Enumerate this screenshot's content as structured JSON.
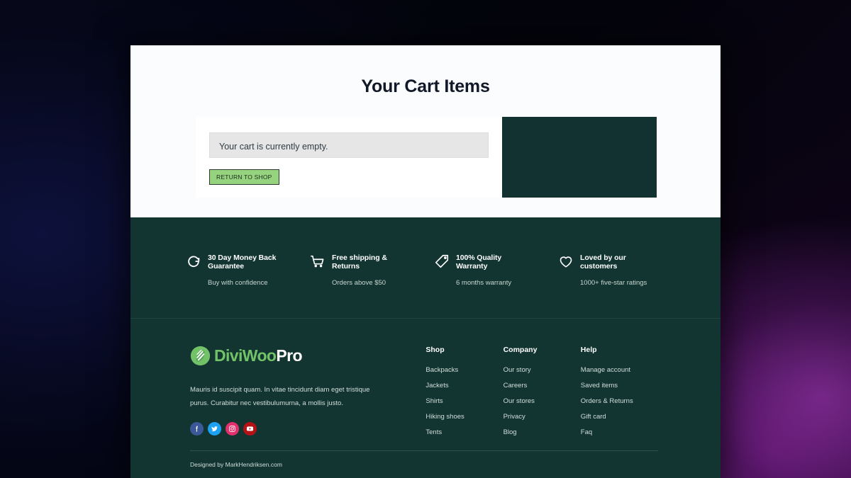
{
  "page": {
    "title": "Your Cart Items"
  },
  "cart": {
    "empty_notice": "Your cart is currently empty.",
    "return_button_label": "RETURN TO SHOP",
    "side_panel_color": "#113230"
  },
  "features": [
    {
      "icon": "refresh-icon",
      "title": "30 Day Money Back Guarantee",
      "subtitle": "Buy with confidence"
    },
    {
      "icon": "shopping-cart-icon",
      "title": "Free shipping & Returns",
      "subtitle": "Orders above $50"
    },
    {
      "icon": "price-tag-icon",
      "title": "100% Quality Warranty",
      "subtitle": "6 months warranty"
    },
    {
      "icon": "heart-icon",
      "title": "Loved by our customers",
      "subtitle": "1000+ five-star ratings"
    }
  ],
  "footer": {
    "logo": {
      "icon": "leaf-circle-icon",
      "word_primary": "DiviWoo",
      "word_secondary": "Pro",
      "primary_color": "#72c368"
    },
    "description": "Mauris id suscipit quam. In vitae tincidunt diam eget tristique purus. Curabitur nec vestibulumurna, a mollis justo.",
    "social": [
      {
        "name": "facebook-icon",
        "color": "#3b5998"
      },
      {
        "name": "twitter-icon",
        "color": "#1da1f2"
      },
      {
        "name": "instagram-icon",
        "color": "#e1306c"
      },
      {
        "name": "youtube-icon",
        "color": "#b31217"
      }
    ],
    "columns": [
      {
        "title": "Shop",
        "links": [
          "Backpacks",
          "Jackets",
          "Shirts",
          "Hiking shoes",
          "Tents"
        ]
      },
      {
        "title": "Company",
        "links": [
          "Our story",
          "Careers",
          "Our stores",
          "Privacy",
          "Blog"
        ]
      },
      {
        "title": "Help",
        "links": [
          "Manage account",
          "Saved items",
          "Orders & Returns",
          "Gift card",
          "Faq"
        ]
      }
    ],
    "credit": "Designed by MarkHendriksen.com"
  },
  "theme": {
    "dark_teal": "#123531",
    "panel_teal": "#113230",
    "accent_green": "#96d37f",
    "logo_green": "#72c368"
  }
}
